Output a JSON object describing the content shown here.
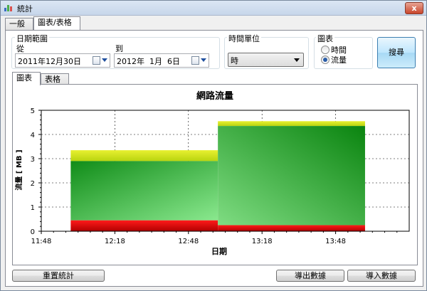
{
  "window": {
    "title": "統計",
    "close_glyph": "x"
  },
  "top_tabs": [
    {
      "label": "一般"
    },
    {
      "label": "圖表/表格",
      "active": true
    }
  ],
  "date_range": {
    "group_label": "日期範圍",
    "from_label": "從",
    "from_value": "2011年12月30日",
    "to_label": "到",
    "to_value": "2012年  1月  6日"
  },
  "time_unit": {
    "group_label": "時間單位",
    "selected": "時"
  },
  "chart_mode": {
    "group_label": "圖表",
    "options": [
      {
        "label": "時間",
        "checked": false
      },
      {
        "label": "流量",
        "checked": true
      }
    ]
  },
  "search_button": "搜尋",
  "inner_tabs": [
    {
      "label": "圖表",
      "active": true
    },
    {
      "label": "表格"
    }
  ],
  "buttons": {
    "reset": "重置統計",
    "export": "導出數據",
    "import": "導入數據"
  },
  "colors": {
    "green_dark": "#0a8a16",
    "green_light": "#86e08a",
    "yellow": "#d8e818",
    "red": "#d40000"
  },
  "chart_data": {
    "type": "area",
    "title": "網路流量",
    "xlabel": "日期",
    "ylabel": "流量 [ MB ]",
    "x_ticks": [
      "11:48",
      "12:18",
      "12:48",
      "13:18",
      "13:48"
    ],
    "y_ticks": [
      "0",
      "1",
      "2",
      "3",
      "4",
      "5"
    ],
    "ylim": [
      0,
      5
    ],
    "xlim": [
      "11:48",
      "14:18"
    ],
    "grid": true,
    "series": [
      {
        "x_start": "12:00",
        "x_end": "13:00",
        "red": 0.45,
        "green": 2.9,
        "yellow": 3.35
      },
      {
        "x_start": "13:00",
        "x_end": "14:00",
        "red": 0.25,
        "green": 4.35,
        "yellow": 4.55
      }
    ]
  }
}
